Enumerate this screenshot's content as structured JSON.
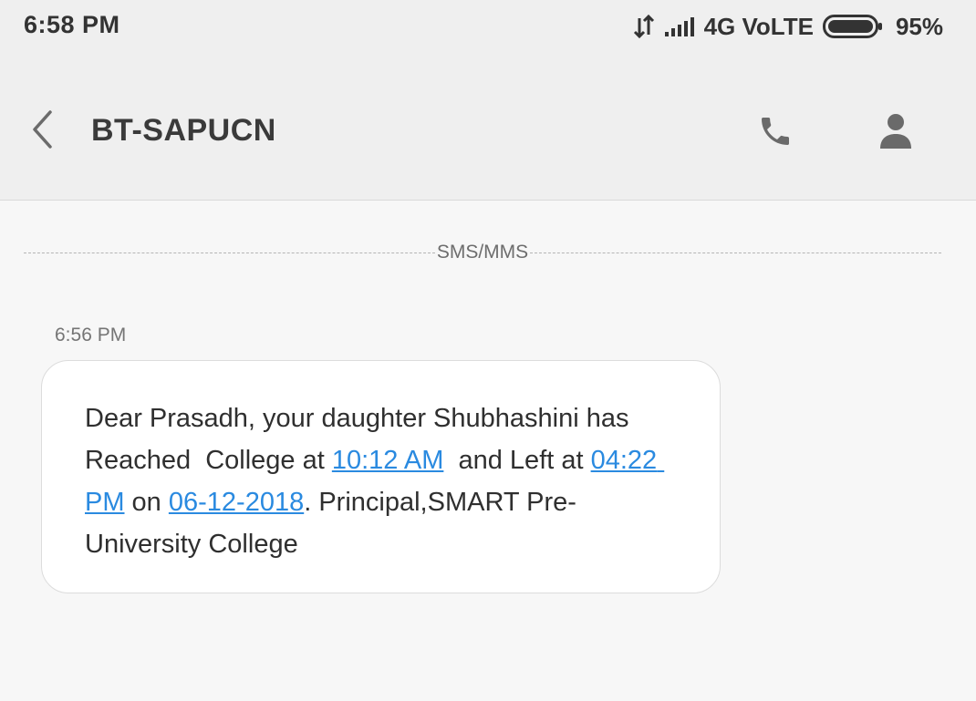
{
  "status_bar": {
    "time": "6:58 PM",
    "network": "4G VoLTE",
    "battery": "95%"
  },
  "app_bar": {
    "title": "BT-SAPUCN",
    "icons": {
      "back": "chevron-left-icon",
      "call": "phone-icon",
      "contact": "person-icon"
    }
  },
  "thread": {
    "divider_label": "SMS/MMS",
    "messages": [
      {
        "time": "6:56 PM",
        "text_1": "Dear Prasadh, your daughter Shubhashini has Reached  College at ",
        "link_1": "10:12 AM",
        "text_2": "  and Left at ",
        "link_2": "04:22 PM",
        "text_3": " on ",
        "link_3": "06-12-2018",
        "text_4": ". Principal,SMART Pre-University College"
      }
    ]
  },
  "colors": {
    "background": "#f7f7f7",
    "bar": "#efefef",
    "link": "#2a8ae0",
    "text": "#2f2f2f"
  }
}
